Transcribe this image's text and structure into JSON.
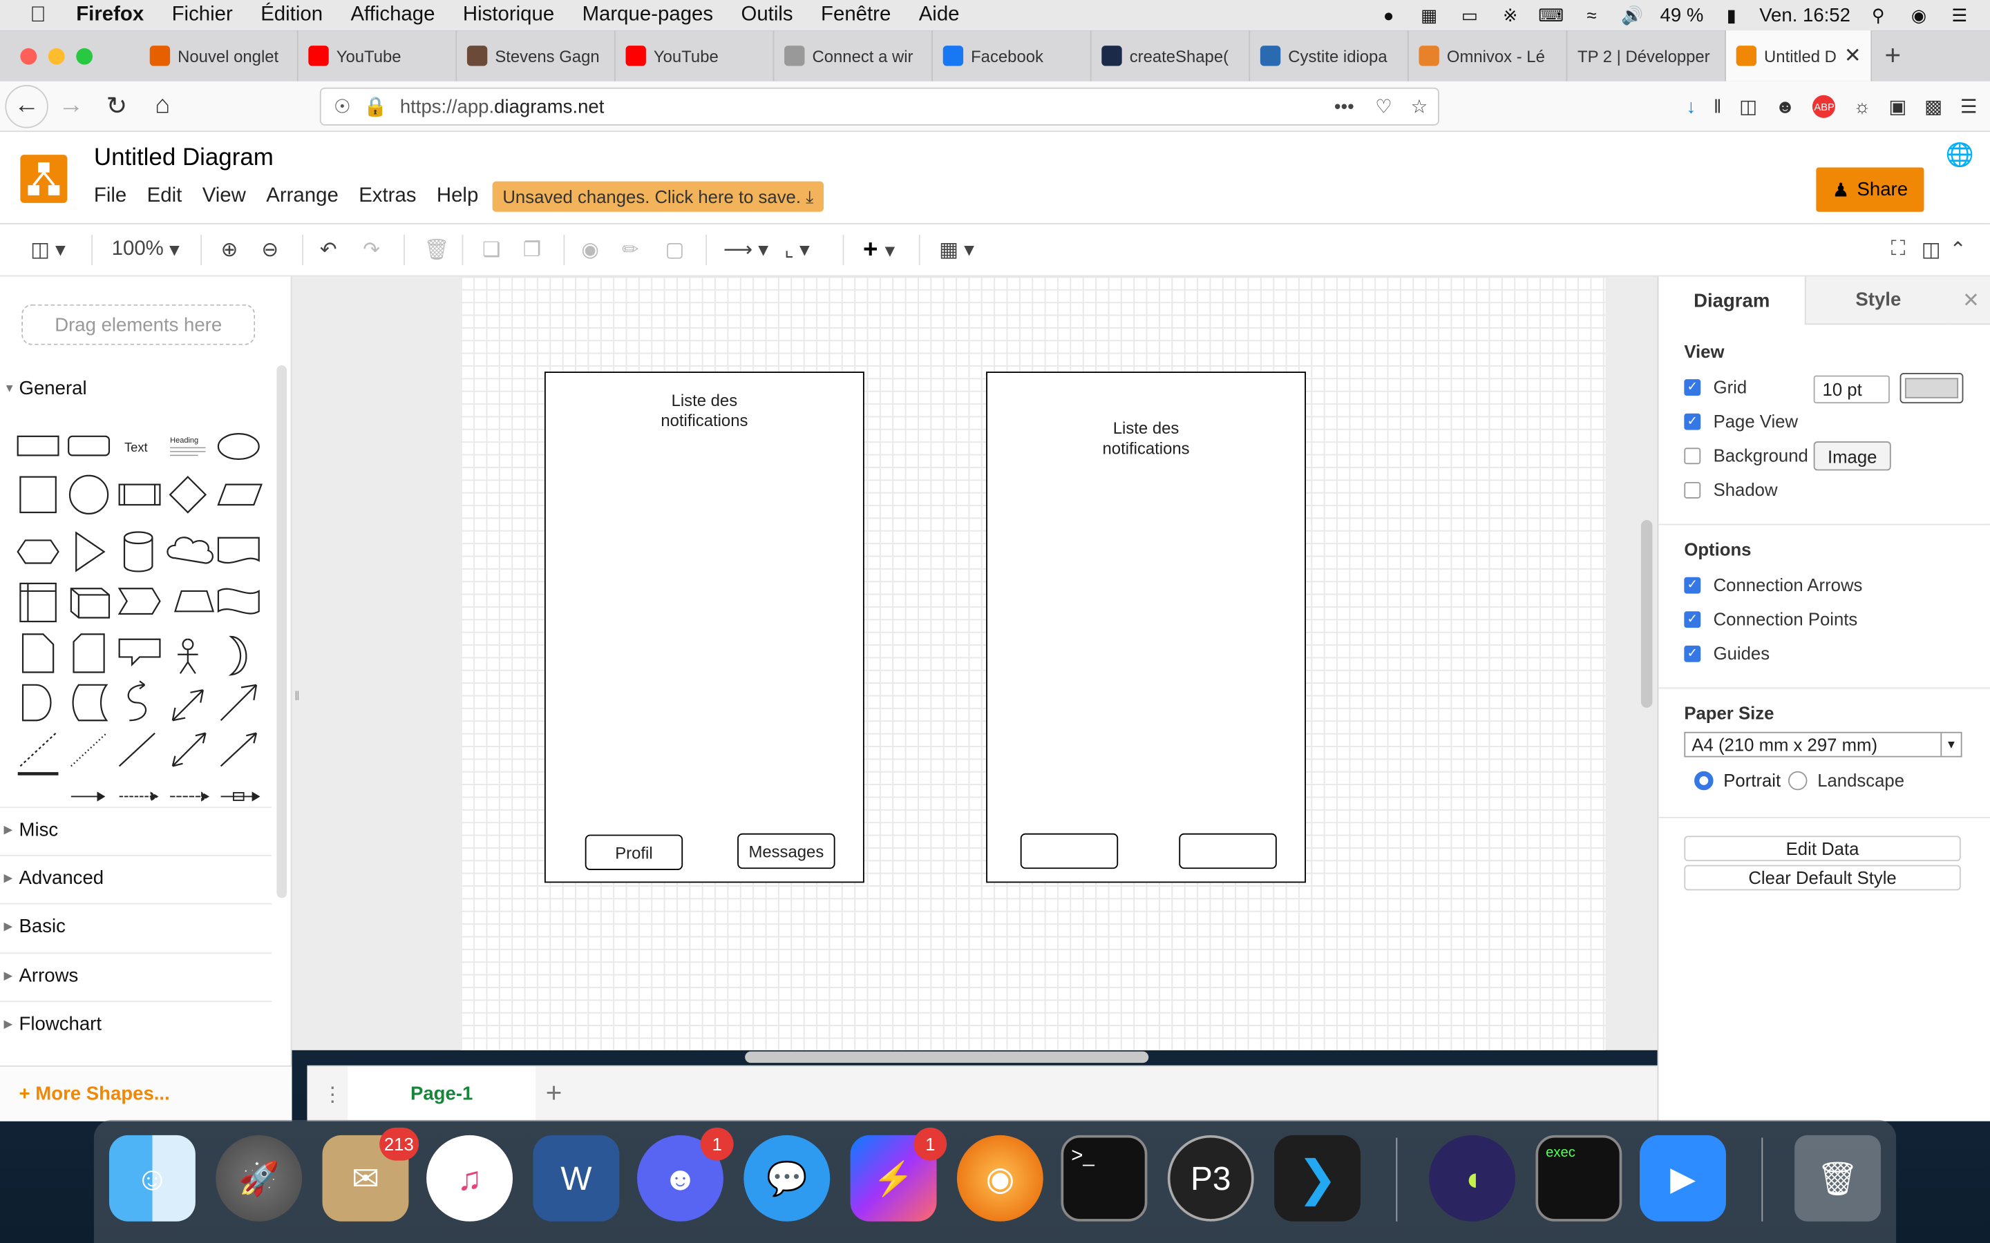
{
  "menubar": {
    "apple": "",
    "app": "Firefox",
    "items": [
      "Fichier",
      "Édition",
      "Affichage",
      "Historique",
      "Marque-pages",
      "Outils",
      "Fenêtre",
      "Aide"
    ],
    "battery": "49 %",
    "clock": "Ven. 16:52"
  },
  "tabs": [
    {
      "label": "Nouvel onglet",
      "fav": "firefox-icon",
      "color": "#e66000"
    },
    {
      "label": "YouTube",
      "fav": "youtube-icon",
      "color": "#ff0000"
    },
    {
      "label": "Stevens Gagn",
      "fav": "user-icon",
      "color": "#6b4a3a"
    },
    {
      "label": "YouTube",
      "fav": "youtube-icon",
      "color": "#ff0000"
    },
    {
      "label": "Connect a wir",
      "fav": "apple-icon",
      "color": "#999999"
    },
    {
      "label": "Facebook",
      "fav": "facebook-icon",
      "color": "#1877f2"
    },
    {
      "label": "createShape(",
      "fav": "p-icon",
      "color": "#1c2a4a"
    },
    {
      "label": "Cystite idiopa",
      "fav": "doc-icon",
      "color": "#2a6ab0"
    },
    {
      "label": "Omnivox - Lé",
      "fav": "flower-icon",
      "color": "#e8822a"
    },
    {
      "label": "TP 2 | Développer",
      "fav": "",
      "color": ""
    },
    {
      "label": "Untitled D",
      "fav": "drawio-icon",
      "color": "#f08705",
      "active": true
    }
  ],
  "url": {
    "prefix": "https://app.",
    "domain": "diagrams.net"
  },
  "app": {
    "title": "Untitled Diagram",
    "menus": [
      "File",
      "Edit",
      "View",
      "Arrange",
      "Extras",
      "Help"
    ],
    "unsaved": "Unsaved changes. Click here to save.",
    "share": "Share"
  },
  "toolbar": {
    "zoom": "100%"
  },
  "sidebar": {
    "drag": "Drag elements here",
    "general": "General",
    "shape_text": "Text",
    "shape_heading": "Heading",
    "sections": [
      "Misc",
      "Advanced",
      "Basic",
      "Arrows",
      "Flowchart"
    ],
    "more": "+ More Shapes..."
  },
  "canvas": {
    "frame1": {
      "label1": "Liste des",
      "label2": "notifications",
      "btn1": "Profil",
      "btn2": "Messages"
    },
    "frame2": {
      "label1": "Liste des",
      "label2": "notifications",
      "btn1": "",
      "btn2": ""
    }
  },
  "pages": {
    "current": "Page-1",
    "add": "+"
  },
  "panel": {
    "tab_diagram": "Diagram",
    "tab_style": "Style",
    "view_head": "View",
    "grid": "Grid",
    "grid_size": "10 pt",
    "page_view": "Page View",
    "background": "Background",
    "image_btn": "Image",
    "shadow": "Shadow",
    "options_head": "Options",
    "conn_arrows": "Connection Arrows",
    "conn_points": "Connection Points",
    "guides": "Guides",
    "paper_head": "Paper Size",
    "paper_value": "A4 (210 mm x 297 mm)",
    "portrait": "Portrait",
    "landscape": "Landscape",
    "edit_data": "Edit Data",
    "clear_style": "Clear Default Style"
  },
  "dock": {
    "mail_badge": "213",
    "discord_badge": "1",
    "messenger_badge": "1",
    "exec_label": "exec"
  },
  "colors": {
    "accent": "#f08705",
    "checkbox": "#3578e5",
    "page_tab": "#17863a"
  }
}
